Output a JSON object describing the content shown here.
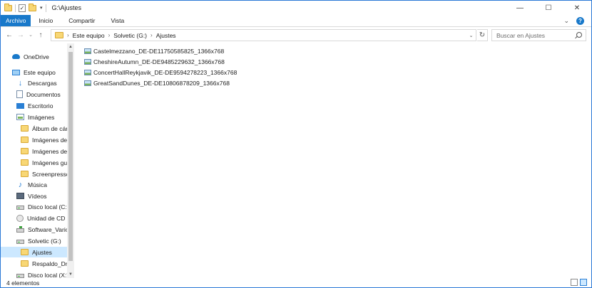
{
  "window": {
    "title": "G:\\Ajustes",
    "minimize_glyph": "—",
    "maximize_glyph": "☐",
    "close_glyph": "✕"
  },
  "ribbon": {
    "tabs": [
      "Archivo",
      "Inicio",
      "Compartir",
      "Vista"
    ],
    "expand_glyph": "⌄",
    "help_glyph": "?"
  },
  "address": {
    "crumbs": [
      "Este equipo",
      "Solvetic (G:)",
      "Ajustes"
    ],
    "separator": "›",
    "back_glyph": "←",
    "forward_glyph": "→",
    "recent_glyph": "⌄",
    "up_glyph": "↑",
    "dropdown_glyph": "⌄",
    "refresh_glyph": "↻"
  },
  "search": {
    "placeholder": "Buscar en Ajustes"
  },
  "nav": {
    "items": [
      {
        "label": "OneDrive",
        "icon": "onedrive-icon"
      },
      {
        "label": "Este equipo",
        "icon": "computer-icon"
      },
      {
        "label": "Descargas",
        "icon": "download-icon"
      },
      {
        "label": "Documentos",
        "icon": "documents-icon"
      },
      {
        "label": "Escritorio",
        "icon": "desktop-icon"
      },
      {
        "label": "Imágenes",
        "icon": "pictures-icon"
      },
      {
        "label": "Álbum de cám",
        "icon": "folder-icon"
      },
      {
        "label": "Imágenes de B",
        "icon": "folder-icon"
      },
      {
        "label": "Imágenes de W",
        "icon": "folder-icon"
      },
      {
        "label": "Imágenes guar",
        "icon": "folder-icon"
      },
      {
        "label": "Screenpresso",
        "icon": "folder-icon"
      },
      {
        "label": "Música",
        "icon": "music-icon"
      },
      {
        "label": "Vídeos",
        "icon": "videos-icon"
      },
      {
        "label": "Disco local (C:)",
        "icon": "drive-icon"
      },
      {
        "label": "Unidad de CD (D",
        "icon": "cd-drive-icon"
      },
      {
        "label": "Software_Varios",
        "icon": "network-drive-icon"
      },
      {
        "label": "Solvetic (G:)",
        "icon": "drive-icon"
      },
      {
        "label": "Ajustes",
        "icon": "folder-icon",
        "selected": true
      },
      {
        "label": "Respaldo_Drive",
        "icon": "folder-icon"
      },
      {
        "label": "Disco local (X:)",
        "icon": "drive-icon"
      }
    ],
    "scroll_up_glyph": "▲",
    "scroll_down_glyph": "▼"
  },
  "files": [
    "Castelmezzano_DE-DE11750585825_1366x768",
    "CheshireAutumn_DE-DE9485229632_1366x768",
    "ConcertHallReykjavik_DE-DE9594278223_1366x768",
    "GreatSandDunes_DE-DE10806878209_1366x768"
  ],
  "status": {
    "count": "4 elementos"
  },
  "colors": {
    "accent": "#1979ca",
    "selection": "#cce8ff",
    "folder": "#f8d775"
  }
}
